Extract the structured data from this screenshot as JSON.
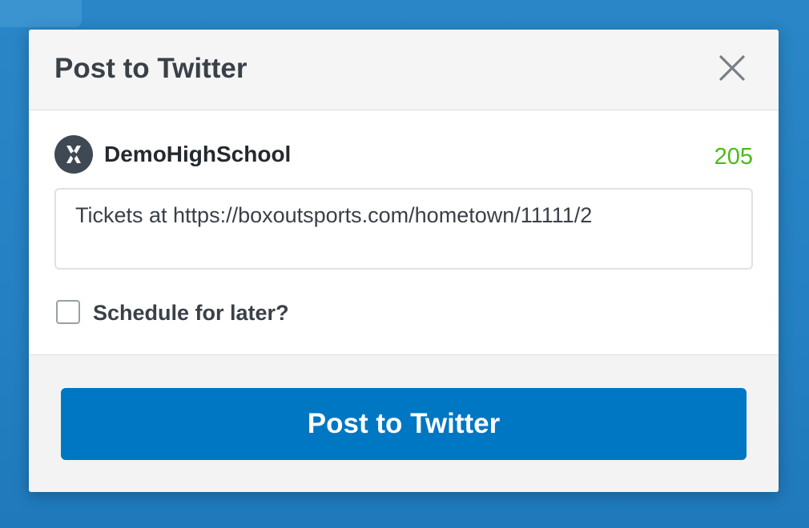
{
  "modal": {
    "title": "Post to Twitter",
    "close_icon": "close-icon"
  },
  "account": {
    "avatar_icon": "school-logo-icon",
    "name": "DemoHighSchool",
    "char_remaining": "205"
  },
  "tweet": {
    "text": "Tickets at https://boxoutsports.com/hometown/11111/2"
  },
  "schedule": {
    "label": "Schedule for later?",
    "checked": false
  },
  "footer": {
    "submit_label": "Post to Twitter"
  },
  "colors": {
    "backdrop": "#2a86c6",
    "primary_button": "#0077c3",
    "char_count": "#4cba1a"
  }
}
